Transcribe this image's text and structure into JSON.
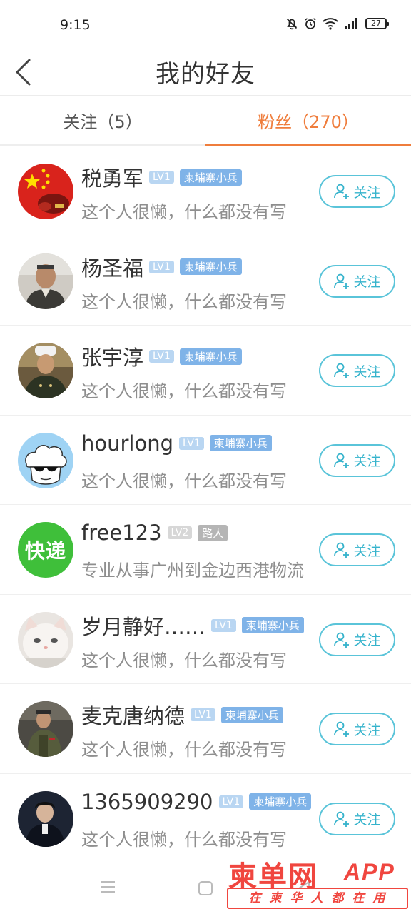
{
  "status_bar": {
    "time": "9:15",
    "battery": "27"
  },
  "header": {
    "title": "我的好友"
  },
  "tabs": [
    {
      "label": "关注（5）",
      "active": false
    },
    {
      "label": "粉丝（270）",
      "active": true
    }
  ],
  "follow_label": "关注",
  "users": [
    {
      "name": "税勇军",
      "level": "LV1",
      "rank": "柬埔寨小兵",
      "bio": "这个人很懒，什么都没有写"
    },
    {
      "name": "杨圣福",
      "level": "LV1",
      "rank": "柬埔寨小兵",
      "bio": "这个人很懒，什么都没有写"
    },
    {
      "name": "张宇淳",
      "level": "LV1",
      "rank": "柬埔寨小兵",
      "bio": "这个人很懒，什么都没有写"
    },
    {
      "name": "hourlong",
      "level": "LV1",
      "rank": "柬埔寨小兵",
      "bio": "这个人很懒，什么都没有写"
    },
    {
      "name": "free123",
      "level": "LV2",
      "rank": "路人",
      "bio": "专业从事广州到金边西港物流"
    },
    {
      "name": "岁月静好……",
      "level": "LV1",
      "rank": "柬埔寨小兵",
      "bio": "这个人很懒，什么都没有写"
    },
    {
      "name": "麦克唐纳德",
      "level": "LV1",
      "rank": "柬埔寨小兵",
      "bio": "这个人很懒，什么都没有写"
    },
    {
      "name": "1365909290",
      "level": "LV1",
      "rank": "柬埔寨小兵",
      "bio": "这个人很懒，什么都没有写"
    }
  ],
  "avatar5_text": "快递",
  "watermark": {
    "logo": "柬单网",
    "app": "APP",
    "slogan": "在柬华人都在用"
  },
  "colors": {
    "accent": "#ef7d3c",
    "follow": "#35b3cc",
    "level_badge": "#b9d6f2",
    "rank_badge": "#7fb3e8",
    "watermark": "#f0463f"
  }
}
